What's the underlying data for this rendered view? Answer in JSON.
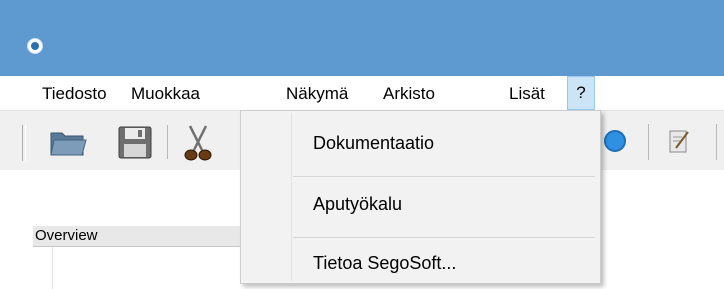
{
  "window": {
    "icon": "app-logo-icon"
  },
  "menubar": {
    "items": [
      {
        "label": "Tiedosto"
      },
      {
        "label": "Muokkaa"
      },
      {
        "label": "Näkymä"
      },
      {
        "label": "Arkisto"
      },
      {
        "label": "Lisät"
      },
      {
        "label": "?"
      }
    ],
    "active_index": 5
  },
  "toolbar": {
    "icons": [
      "open-folder-icon",
      "save-disk-icon",
      "cut-scissors-icon",
      "globe-icon",
      "document-edit-icon"
    ]
  },
  "help_menu": {
    "items": [
      {
        "label": "Dokumentaatio"
      },
      {
        "label": "Aputyökalu"
      },
      {
        "label": "Tietoa SegoSoft..."
      }
    ]
  },
  "left_pane": {
    "header": "Overview"
  }
}
